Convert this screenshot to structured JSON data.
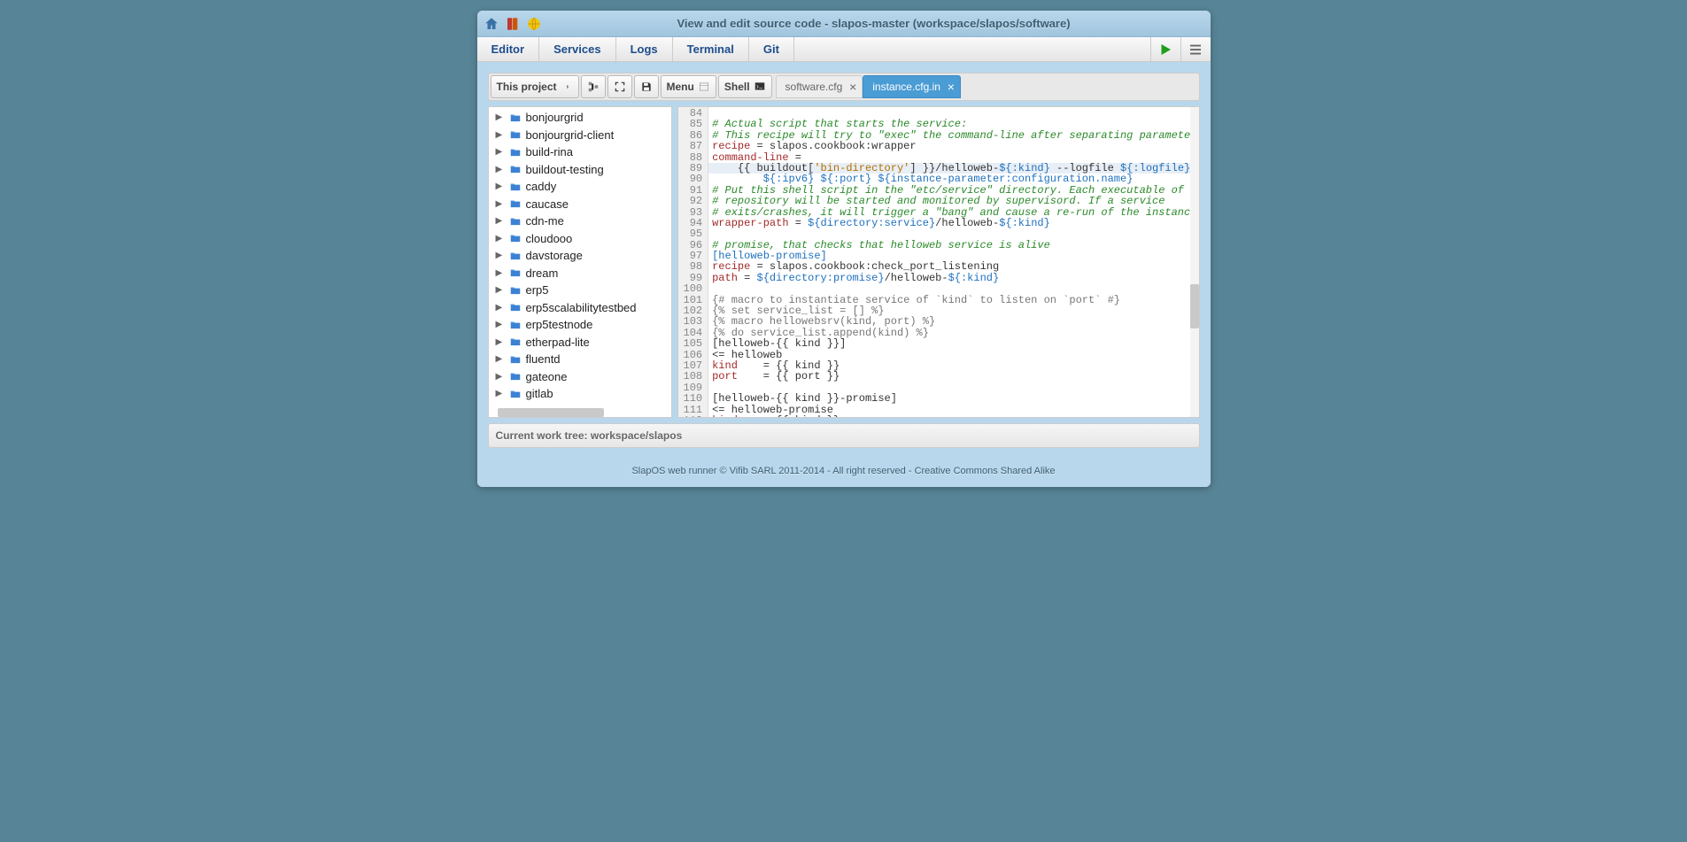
{
  "titlebar": {
    "title": "View and edit source code - slapos-master (workspace/slapos/software)"
  },
  "nav": {
    "tabs": [
      "Editor",
      "Services",
      "Logs",
      "Terminal",
      "Git"
    ]
  },
  "toolbar": {
    "project_btn": "This project",
    "menu_btn": "Menu",
    "shell_btn": "Shell"
  },
  "file_tabs": {
    "inactive": "software.cfg",
    "active": "instance.cfg.in"
  },
  "tree": {
    "items": [
      "bonjourgrid",
      "bonjourgrid-client",
      "build-rina",
      "buildout-testing",
      "caddy",
      "caucase",
      "cdn-me",
      "cloudooo",
      "davstorage",
      "dream",
      "erp5",
      "erp5scalabilitytestbed",
      "erp5testnode",
      "etherpad-lite",
      "fluentd",
      "gateone",
      "gitlab"
    ]
  },
  "gutter": {
    "start": 84,
    "end": 112
  },
  "code": {
    "l84": "",
    "l85": "# Actual script that starts the service:",
    "l86": "# This recipe will try to \"exec\" the command-line after separating parameters.",
    "l87a": "recipe",
    "l87b": " = slapos.cookbook:wrapper",
    "l88a": "command-line",
    "l88b": " =",
    "l89a": "    {{ buildout[",
    "l89b": "'bin-directory'",
    "l89c": "] }}/helloweb-",
    "l89d": "${:kind}",
    "l89e": " --logfile ",
    "l89f": "${:logfile}",
    "l90a": "        ",
    "l90b": "${:ipv6}",
    "l90c": " ",
    "l90d": "${:port}",
    "l90e": " ",
    "l90f": "${instance-parameter:configuration.name}",
    "l91": "# Put this shell script in the \"etc/service\" directory. Each executable of this",
    "l92": "# repository will be started and monitored by supervisord. If a service",
    "l93": "# exits/crashes, it will trigger a \"bang\" and cause a re-run of the instance.",
    "l94a": "wrapper-path",
    "l94b": " = ",
    "l94c": "${directory:service}",
    "l94d": "/helloweb-",
    "l94e": "${:kind}",
    "l95": "",
    "l96": "# promise, that checks that helloweb service is alive",
    "l97": "[helloweb-promise]",
    "l98a": "recipe",
    "l98b": " = slapos.cookbook:check_port_listening",
    "l99a": "path",
    "l99b": " = ",
    "l99c": "${directory:promise}",
    "l99d": "/helloweb-",
    "l99e": "${:kind}",
    "l100": "",
    "l101": "{# macro to instantiate service of `kind` to listen on `port` #}",
    "l102": "{% set service_list = [] %}",
    "l103": "{% macro hellowebsrv(kind, port) %}",
    "l104": "{% do service_list.append(kind) %}",
    "l105": "[helloweb-{{ kind }}]",
    "l106": "&lt;= helloweb",
    "l107a": "kind",
    "l107b": "    = {{ kind }}",
    "l108a": "port",
    "l108b": "    = {{ port }}",
    "l109": "",
    "l110": "[helloweb-{{ kind }}-promise]",
    "l111": "&lt;= helloweb-promise",
    "l112a": "kind",
    "l112b": "    = {{ kind }}"
  },
  "status": {
    "worktree": "Current work tree: workspace/slapos"
  },
  "footer": {
    "text": "SlapOS web runner © Vifib SARL 2011-2014 - All right reserved - Creative Commons Shared Alike"
  }
}
